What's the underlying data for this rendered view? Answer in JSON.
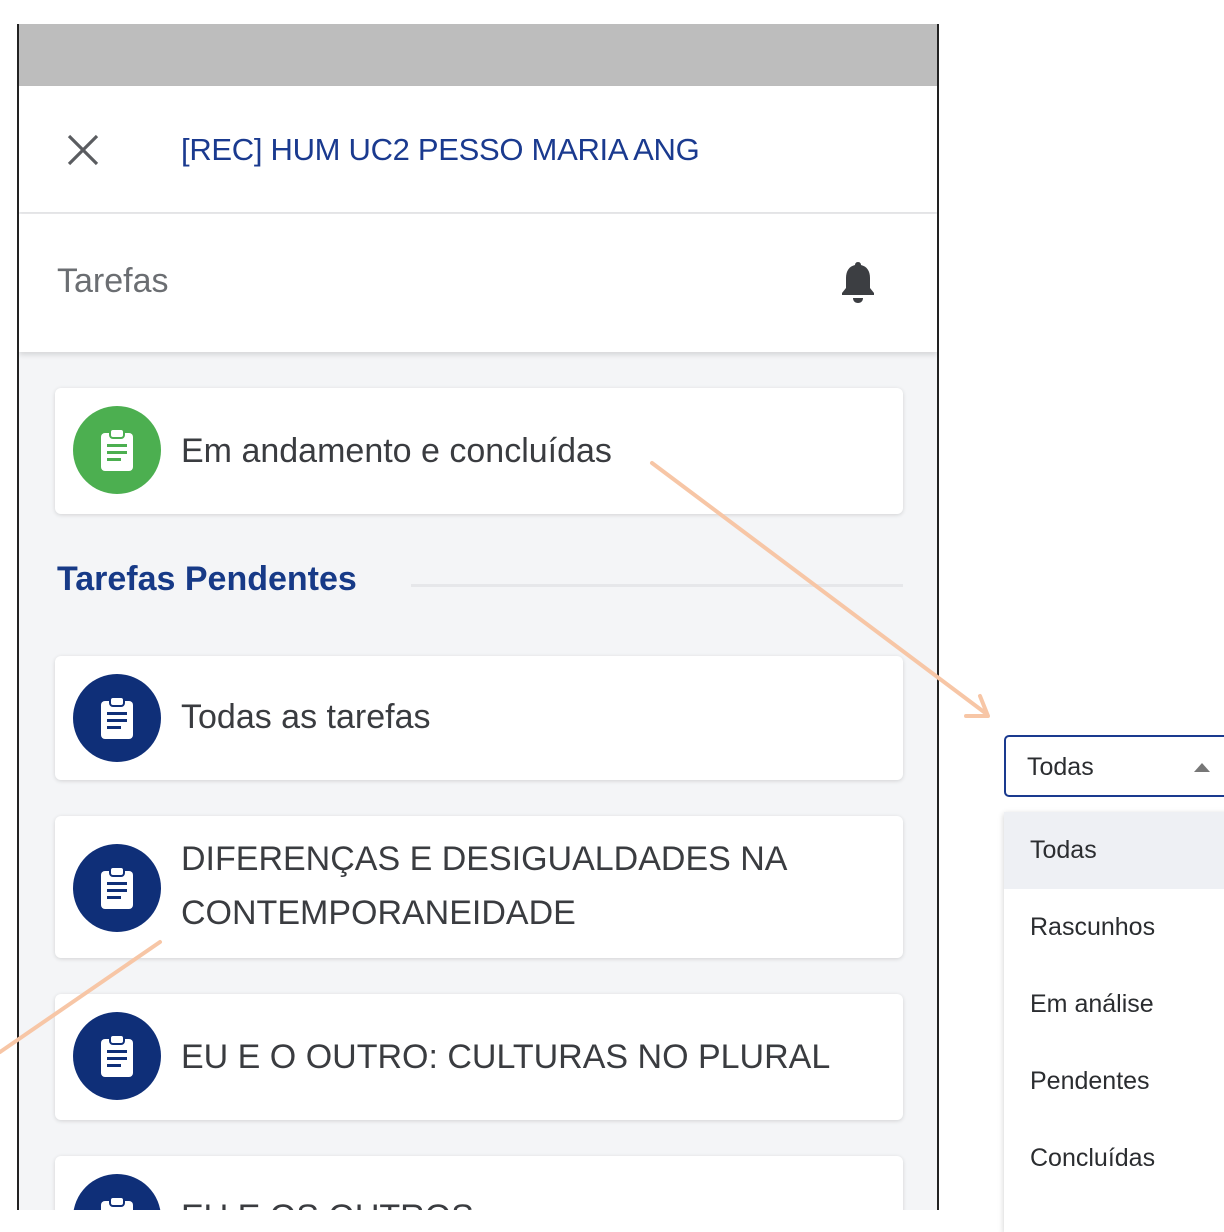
{
  "header": {
    "course_title": "[REC] HUM UC2 PESSO MARIA ANG",
    "close_icon": "close-icon"
  },
  "subheader": {
    "title": "Tarefas",
    "bell_icon": "bell-icon"
  },
  "summary_card": {
    "label": "Em andamento e concluídas",
    "icon": "clipboard-icon",
    "icon_bg": "#4caf50"
  },
  "section": {
    "title": "Tarefas Pendentes"
  },
  "task_cards": [
    {
      "line1": "Todas as tarefas",
      "line2": ""
    },
    {
      "line1": "DIFERENÇAS E DESIGUALDADES NA",
      "line2": "CONTEMPORANEIDADE"
    },
    {
      "line1": "EU E O OUTRO: CULTURAS NO PLURAL",
      "line2": ""
    },
    {
      "line1": "EU E OS OUTROS",
      "line2": ""
    }
  ],
  "task_icon_bg": "#0f2f78",
  "filter_dropdown": {
    "value": "Todas",
    "options": [
      "Todas",
      "Rascunhos",
      "Em análise",
      "Pendentes",
      "Concluídas"
    ],
    "selected": "Todas"
  },
  "colors": {
    "accent": "#1a3a8f",
    "annotation_arrow": "#f7c6a6",
    "status_bar": "#bdbdbd"
  }
}
